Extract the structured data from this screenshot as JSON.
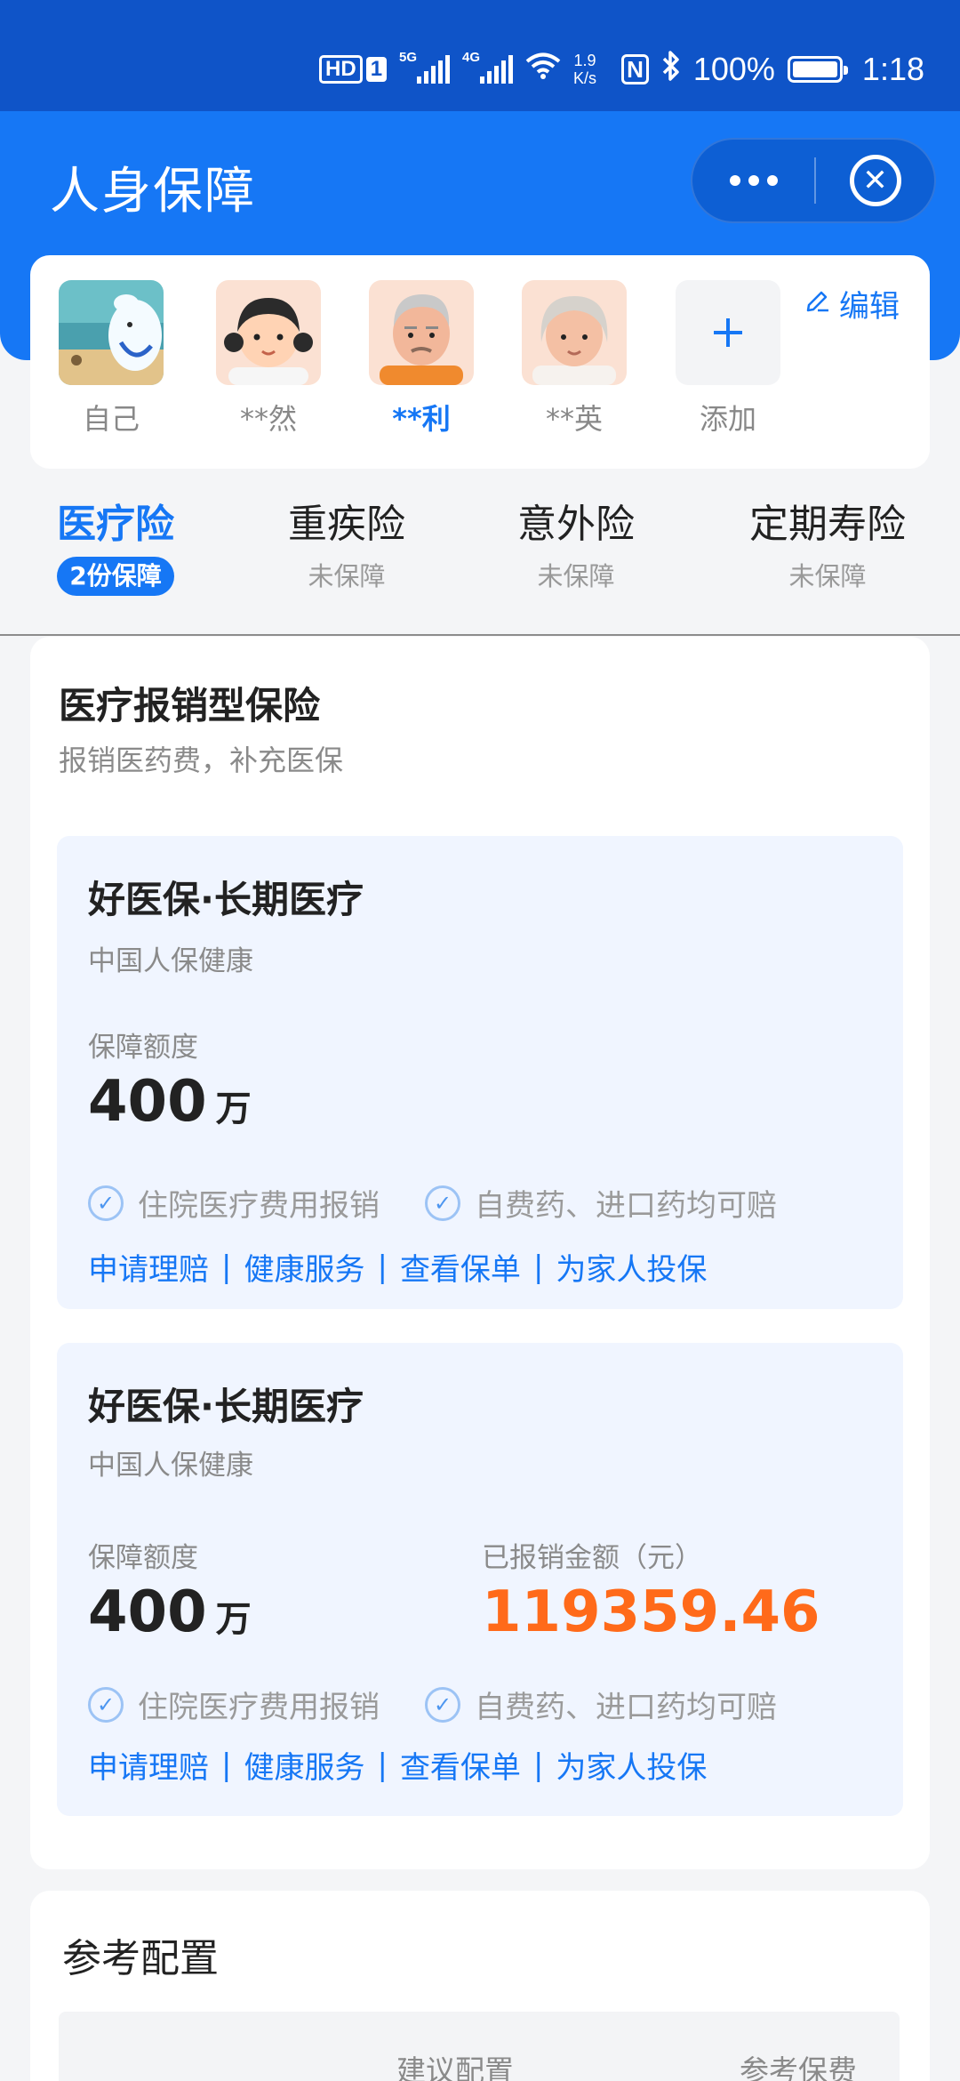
{
  "status_bar": {
    "hd": "HD",
    "sim": "1",
    "net1": "5G",
    "net2": "4G",
    "speed_value": "1.9",
    "speed_unit": "K/s",
    "nfc": "N",
    "battery": "100%",
    "time": "1:18"
  },
  "header": {
    "title": "人身保障"
  },
  "family": {
    "members": [
      {
        "name": "自己"
      },
      {
        "name": "**然"
      },
      {
        "name": "**利"
      },
      {
        "name": "**英"
      }
    ],
    "add_label": "添加",
    "edit_label": "编辑"
  },
  "tabs": [
    {
      "label": "医疗险",
      "status": "2份保障"
    },
    {
      "label": "重疾险",
      "status": "未保障"
    },
    {
      "label": "意外险",
      "status": "未保障"
    },
    {
      "label": "定期寿险",
      "status": "未保障"
    }
  ],
  "section": {
    "title": "医疗报销型保险",
    "subtitle": "报销医药费，补充医保"
  },
  "policies": [
    {
      "name": "好医保·长期医疗",
      "insurer": "中国人保健康",
      "coverage_label": "保障额度",
      "coverage_value": "400",
      "coverage_unit": "万",
      "features": [
        "住院医疗费用报销",
        "自费药、进口药均可赔"
      ],
      "links": [
        "申请理赔",
        "健康服务",
        "查看保单",
        "为家人投保"
      ]
    },
    {
      "name": "好医保·长期医疗",
      "insurer": "中国人保健康",
      "coverage_label": "保障额度",
      "coverage_value": "400",
      "coverage_unit": "万",
      "reimbursed_label": "已报销金额（元）",
      "reimbursed_value": "119359.46",
      "features": [
        "住院医疗费用报销",
        "自费药、进口药均可赔"
      ],
      "links": [
        "申请理赔",
        "健康服务",
        "查看保单",
        "为家人投保"
      ]
    }
  ],
  "reference": {
    "title": "参考配置",
    "col_suggest": "建议配置",
    "col_premium": "参考保费"
  },
  "colors": {
    "brand_blue": "#1677f5",
    "status_bar_blue": "#0f54c8",
    "amount_orange": "#ff6a1a",
    "policy_bg": "#f0f5ff"
  }
}
